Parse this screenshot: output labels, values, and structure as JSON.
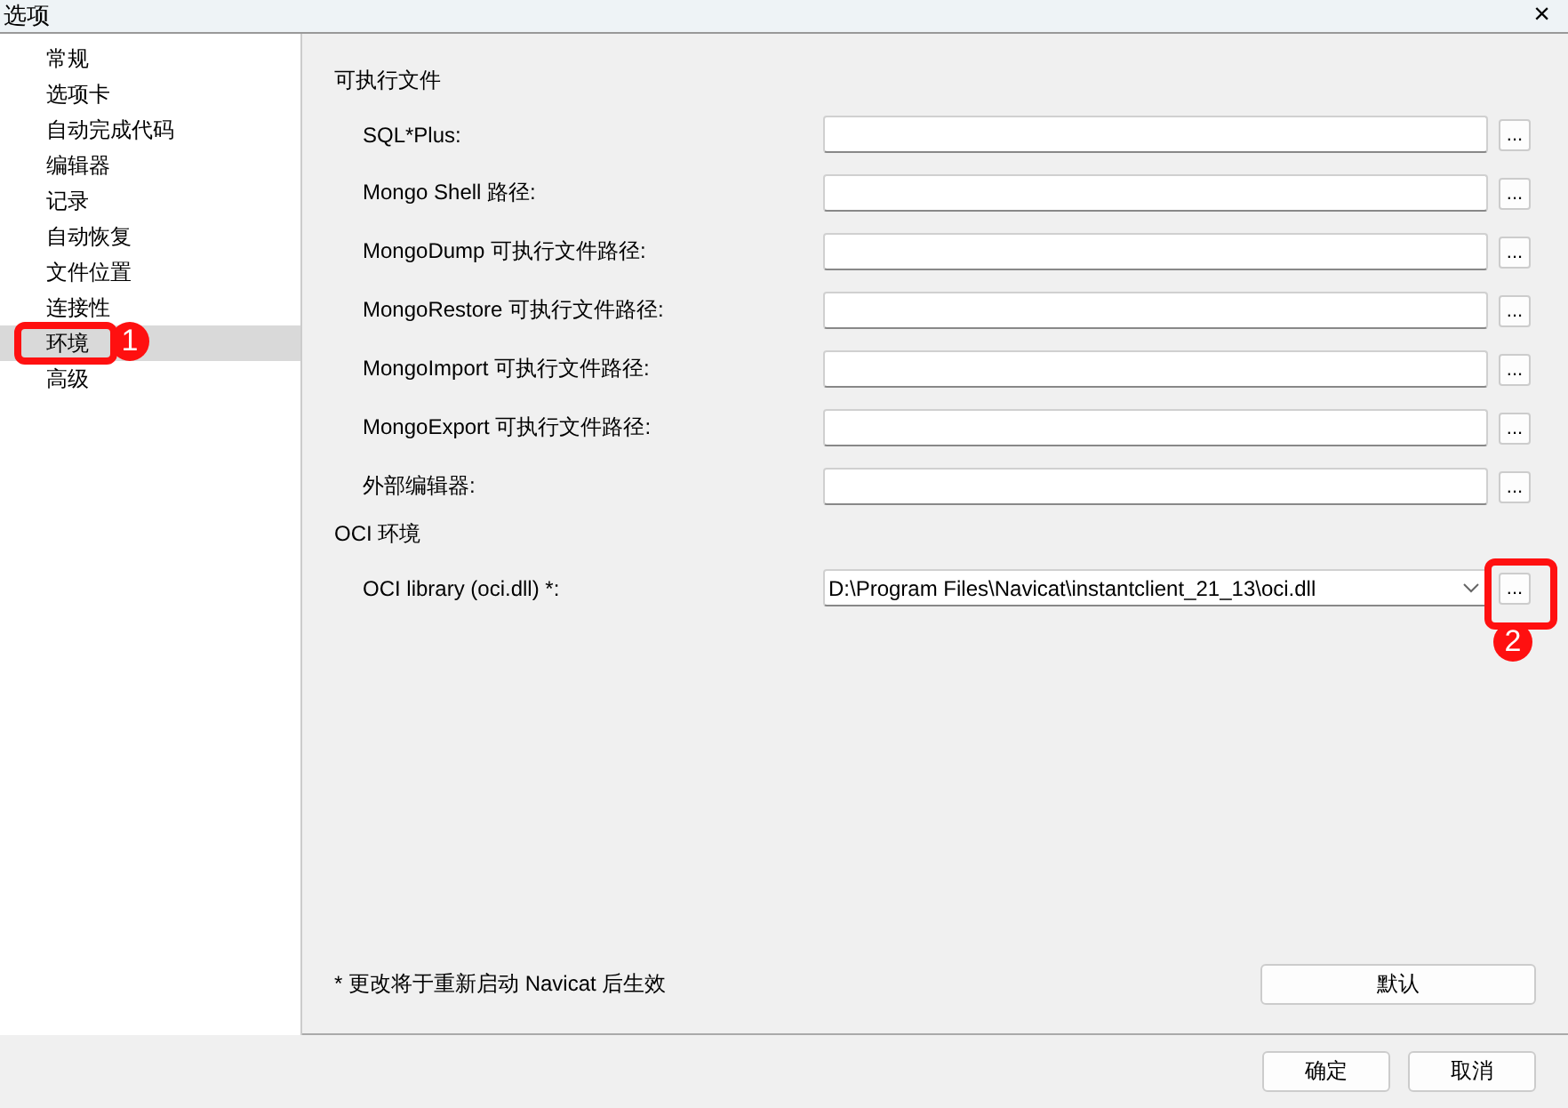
{
  "window": {
    "title": "选项",
    "close": "×"
  },
  "sidebar": {
    "items": [
      {
        "label": "常规",
        "selected": false
      },
      {
        "label": "选项卡",
        "selected": false
      },
      {
        "label": "自动完成代码",
        "selected": false
      },
      {
        "label": "编辑器",
        "selected": false
      },
      {
        "label": "记录",
        "selected": false
      },
      {
        "label": "自动恢复",
        "selected": false
      },
      {
        "label": "文件位置",
        "selected": false
      },
      {
        "label": "连接性",
        "selected": false
      },
      {
        "label": "环境",
        "selected": true
      },
      {
        "label": "高级",
        "selected": false
      }
    ]
  },
  "sections": [
    {
      "title": "可执行文件",
      "fields": [
        {
          "label": "SQL*Plus:",
          "kind": "text",
          "browse": "..."
        },
        {
          "label": "Mongo Shell 路径:",
          "kind": "text",
          "browse": "..."
        },
        {
          "label": "MongoDump 可执行文件路径:",
          "kind": "text",
          "browse": "..."
        },
        {
          "label": "MongoRestore 可执行文件路径:",
          "kind": "text",
          "browse": "..."
        },
        {
          "label": "MongoImport 可执行文件路径:",
          "kind": "text",
          "browse": "..."
        },
        {
          "label": "MongoExport 可执行文件路径:",
          "kind": "text",
          "browse": "..."
        },
        {
          "label": "外部编辑器:",
          "kind": "text",
          "browse": "..."
        }
      ]
    },
    {
      "title": "OCI 环境",
      "fields": [
        {
          "label": "OCI library (oci.dll) *:",
          "kind": "combo",
          "value": "D:\\Program Files\\Navicat\\instantclient_21_13\\oci.dll",
          "browse": "..."
        }
      ]
    }
  ],
  "note": "* 更改将于重新启动 Navicat 后生效",
  "default_button": "默认",
  "buttons": [
    "确定",
    "取消"
  ],
  "annotations": [
    {
      "label": "1"
    },
    {
      "label": "2"
    }
  ]
}
